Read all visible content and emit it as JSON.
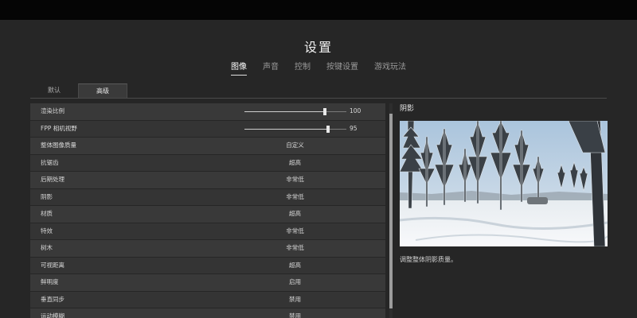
{
  "header": {
    "title": "设置"
  },
  "main_tabs": [
    {
      "label": "图像",
      "active": true
    },
    {
      "label": "声音",
      "active": false
    },
    {
      "label": "控制",
      "active": false
    },
    {
      "label": "按键设置",
      "active": false
    },
    {
      "label": "游戏玩法",
      "active": false
    }
  ],
  "sub_tabs": [
    {
      "label": "默认",
      "active": false
    },
    {
      "label": "高级",
      "active": true
    }
  ],
  "settings": [
    {
      "label": "渲染比例",
      "type": "slider",
      "value": "100",
      "fraction": 0.79
    },
    {
      "label": "FPP 相机视野",
      "type": "slider",
      "value": "95",
      "fraction": 0.82
    },
    {
      "label": "整体图像质量",
      "type": "option",
      "value": "自定义"
    },
    {
      "label": "抗锯齿",
      "type": "option",
      "value": "超高"
    },
    {
      "label": "后期处理",
      "type": "option",
      "value": "非常低"
    },
    {
      "label": "阴影",
      "type": "option",
      "value": "非常低"
    },
    {
      "label": "材质",
      "type": "option",
      "value": "超高"
    },
    {
      "label": "特效",
      "type": "option",
      "value": "非常低"
    },
    {
      "label": "树木",
      "type": "option",
      "value": "非常低"
    },
    {
      "label": "可视距离",
      "type": "option",
      "value": "超高"
    },
    {
      "label": "鲜明度",
      "type": "option",
      "value": "启用"
    },
    {
      "label": "垂直同步",
      "type": "option",
      "value": "禁用"
    },
    {
      "label": "运动模糊",
      "type": "option",
      "value": "禁用"
    }
  ],
  "preview": {
    "title": "阴影",
    "description": "调整整体阴影质量。"
  },
  "colors": {
    "background": "#262626",
    "row": "#373737",
    "accent": "#e8e8e8"
  }
}
